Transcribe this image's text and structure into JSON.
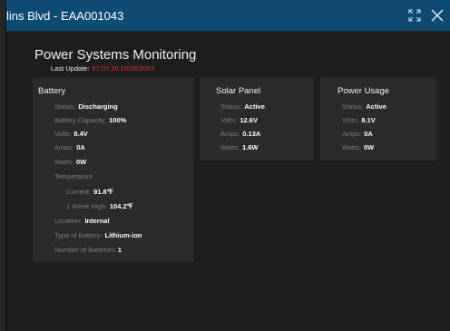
{
  "window": {
    "title": "lins Blvd - EAA001043",
    "expand_icon": "expand-icon",
    "close_icon": "close-icon"
  },
  "header": {
    "title": "Power Systems Monitoring",
    "last_update_label": "Last Update:",
    "last_update_value": "07:07:10 10/26/2023"
  },
  "battery": {
    "title": "Battery",
    "status_label": "Status:",
    "status_value": "Discharging",
    "capacity_label": "Battery Capacity:",
    "capacity_value": "100%",
    "volts_label": "Volts:",
    "volts_value": "8.4V",
    "amps_label": "Amps:",
    "amps_value": "0A",
    "watts_label": "Watts:",
    "watts_value": "0W",
    "temperature_label": "Temperature",
    "current_label": "Current:",
    "current_value": "91.8℉",
    "week_high_label": "1 Week High:",
    "week_high_value": "104.2℉",
    "location_label": "Location:",
    "location_value": "Internal",
    "type_label": "Type of Battery:",
    "type_value": "Lithium-ion",
    "number_label": "Number of Batteries:",
    "number_value": "1"
  },
  "solar": {
    "title": "Solar Panel",
    "status_label": "Status:",
    "status_value": "Active",
    "volts_label": "Volts:",
    "volts_value": "12.6V",
    "amps_label": "Amps:",
    "amps_value": "0.13A",
    "watts_label": "Watts:",
    "watts_value": "1.6W"
  },
  "usage": {
    "title": "Power Usage",
    "status_label": "Status:",
    "status_value": "Active",
    "volts_label": "Volts:",
    "volts_value": "8.1V",
    "amps_label": "Amps:",
    "amps_value": "0A",
    "watts_label": "Watts:",
    "watts_value": "0W"
  },
  "colors": {
    "titlebar": "#0f4a73",
    "timestamp": "#d9302a",
    "card": "#2b2b2b"
  }
}
